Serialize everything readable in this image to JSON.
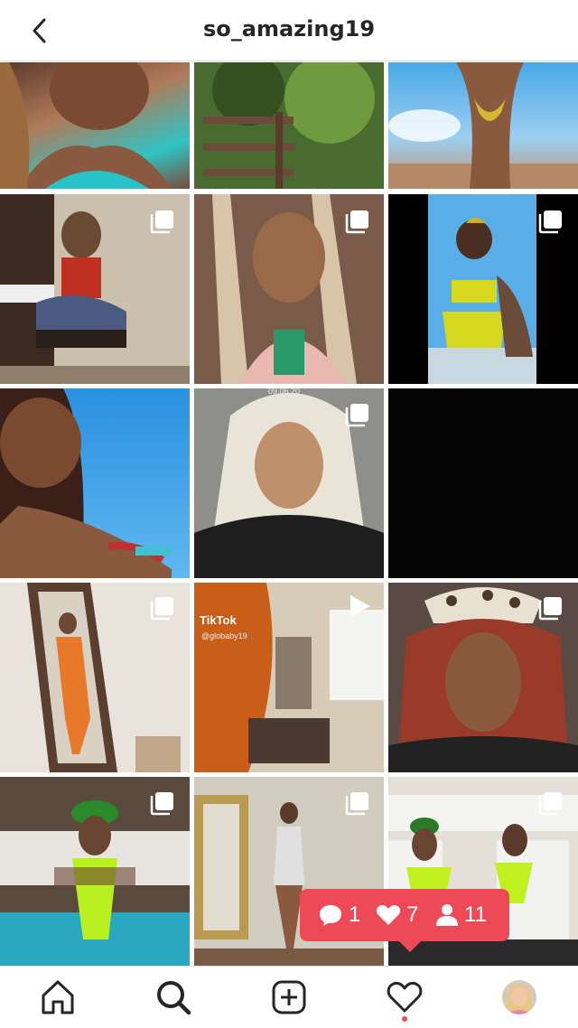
{
  "header": {
    "title": "so_amazing19",
    "back_icon": "chevron-left-icon"
  },
  "grid": {
    "posts": [
      {
        "name": "post-1",
        "desc": "selfie teal top",
        "badge": ""
      },
      {
        "name": "post-2",
        "desc": "forest deck",
        "badge": ""
      },
      {
        "name": "post-3",
        "desc": "bikini sky",
        "badge": ""
      },
      {
        "name": "post-4",
        "desc": "piano pose",
        "badge": "multi"
      },
      {
        "name": "post-5",
        "desc": "braids selfie",
        "badge": "multi"
      },
      {
        "name": "post-6",
        "desc": "snakeskin bikini",
        "badge": "multi"
      },
      {
        "name": "post-7",
        "desc": "beach selfie",
        "badge": ""
      },
      {
        "name": "post-8",
        "desc": "platinum hair selfie",
        "badge": "multi"
      },
      {
        "name": "post-9",
        "desc": "black image",
        "badge": ""
      },
      {
        "name": "post-10",
        "desc": "mirror orange outfit",
        "badge": "multi"
      },
      {
        "name": "post-11",
        "desc": "tiktok video",
        "badge": "video"
      },
      {
        "name": "post-12",
        "desc": "leopard hat selfie",
        "badge": "multi"
      },
      {
        "name": "post-13",
        "desc": "pool swimsuit",
        "badge": "multi"
      },
      {
        "name": "post-14",
        "desc": "hallway swimsuit",
        "badge": "multi"
      },
      {
        "name": "post-15",
        "desc": "pool lounge chairs",
        "badge": "multi"
      }
    ],
    "tiktok_label": "TikTok",
    "tiktok_user": "@globaby19",
    "timestamp_text": "09.06.20"
  },
  "activity": {
    "comments": "1",
    "likes": "7",
    "follows": "11",
    "color": "#ed4956"
  },
  "navbar": {
    "items": [
      "home-icon",
      "search-icon",
      "add-post-icon",
      "heart-icon",
      "profile-avatar"
    ],
    "notification_color": "#ed4956"
  }
}
